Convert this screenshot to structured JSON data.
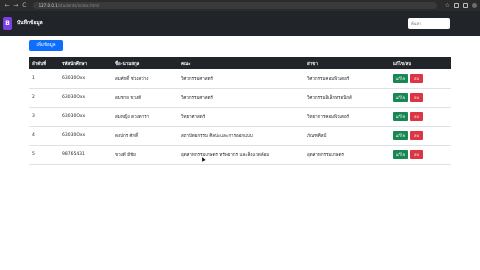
{
  "browser": {
    "back": "←",
    "forward": "→",
    "reload": "C",
    "url": "127.0.0.1",
    "url_faint": "/students/index.html",
    "star": "☆"
  },
  "app": {
    "logo": "B",
    "brand": "บันทึกข้อมูล",
    "search_placeholder": "ค้นหา"
  },
  "add_button": "เพิ่มข้อมูล",
  "table": {
    "headers": [
      "ลำดับที่",
      "รหัสนักศึกษา",
      "ชื่อ-นามสกุล",
      "คณะ",
      "สาขา",
      "แก้ไข/ลบ"
    ],
    "rows": [
      {
        "no": "1",
        "id": "63030Oxx",
        "name": "สมศักดิ์ ช่วงสว่าง",
        "faculty": "วิศวกรรมศาสตร์",
        "major": "วิศวกรรมคอมพิวเตอร์"
      },
      {
        "no": "2",
        "id": "63030Oxx",
        "name": "สมชาย ขวงดี",
        "faculty": "วิศวกรรมศาสตร์",
        "major": "วิศวกรรมอิเล็กทรอนิกส์"
      },
      {
        "no": "3",
        "id": "63030Oxx",
        "name": "สมหญิง ดวงดารา",
        "faculty": "วิทยาศาสตร์",
        "major": "วิทยาการคอมพิวเตอร์"
      },
      {
        "no": "4",
        "id": "63030Oxx",
        "name": "ดงปกร ศักดิ์",
        "faculty": "สถาปัตยกรรม ศิลปะและการออกแบบ",
        "major": "ภัณฑศิลป์"
      },
      {
        "no": "5",
        "id": "98765431",
        "name": "ขวงดี มีชัย",
        "faculty": "อุตสาหกรรมเกษตร ทรัพยากร และสิ่งแวดล้อม",
        "major": "อุตสาหกรรมเกษตร"
      }
    ],
    "edit_label": "แก้ไข",
    "delete_label": "ลบ"
  }
}
